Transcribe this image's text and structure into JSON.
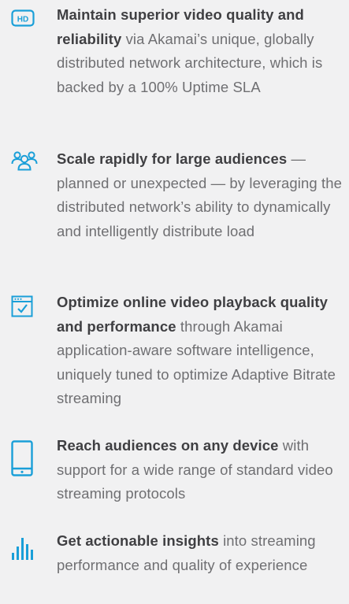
{
  "features": [
    {
      "icon": "hd-icon",
      "headline": "Maintain superior video quality and reliability",
      "body": " via Akamai’s unique, globally distributed network architecture, which is backed by a 100% Uptime SLA"
    },
    {
      "icon": "audience-icon",
      "headline": "Scale rapidly for large audiences",
      "body": " — planned or unexpected — by leveraging the distributed network’s ability to dynamically and intelligently distribute load"
    },
    {
      "icon": "browser-check-icon",
      "headline": "Optimize online video playback quality and performance",
      "body": " through Akamai application-aware software intelligence, uniquely tuned to optimize Adaptive Bitrate streaming"
    },
    {
      "icon": "mobile-device-icon",
      "headline": "Reach audiences on any device",
      "body": " with support for a wide range of standard video streaming protocols"
    },
    {
      "icon": "bar-chart-icon",
      "headline": "Get actionable insights",
      "body": " into streaming performance and quality of experience"
    }
  ],
  "colors": {
    "accent": "#1a9fd8",
    "background": "#f1f1f2",
    "headline": "#3f3f42",
    "body": "#6f6f72"
  }
}
